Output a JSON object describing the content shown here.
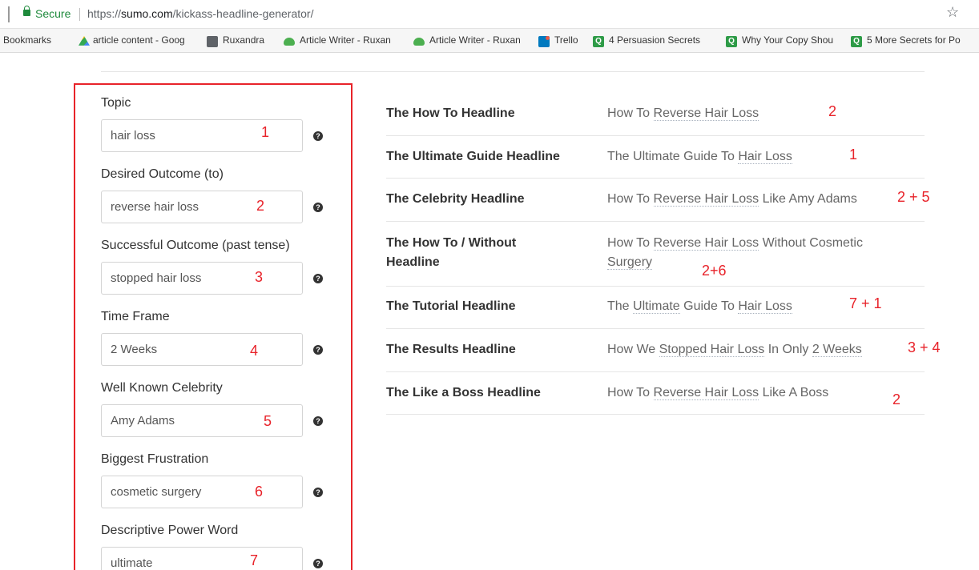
{
  "browser": {
    "secure_label": "Secure",
    "url_scheme": "https://",
    "url_host": "sumo.com",
    "url_path": "/kickass-headline-generator/",
    "bookmarks": [
      {
        "label": "Bookmarks",
        "icon": "none"
      },
      {
        "label": "article content - Goog",
        "icon": "google-drive-icon"
      },
      {
        "label": "Ruxandra",
        "icon": "folder-icon"
      },
      {
        "label": "Article Writer - Ruxan",
        "icon": "cloud-icon"
      },
      {
        "label": "Article Writer - Ruxan",
        "icon": "cloud-icon"
      },
      {
        "label": "Trello",
        "icon": "trello-icon"
      },
      {
        "label": "4 Persuasion Secrets",
        "icon": "q-icon"
      },
      {
        "label": "Why Your Copy Shou",
        "icon": "q-icon"
      },
      {
        "label": "5 More Secrets for Po",
        "icon": "q-icon"
      }
    ]
  },
  "form": {
    "fields": [
      {
        "label": "Topic",
        "value": "hair loss",
        "annotation": "1"
      },
      {
        "label": "Desired Outcome (to)",
        "value": "reverse hair loss",
        "annotation": "2"
      },
      {
        "label": "Successful Outcome (past tense)",
        "value": "stopped hair loss",
        "annotation": "3"
      },
      {
        "label": "Time Frame",
        "value": "2 Weeks",
        "annotation": "4"
      },
      {
        "label": "Well Known Celebrity",
        "value": "Amy Adams",
        "annotation": "5"
      },
      {
        "label": "Biggest Frustration",
        "value": "cosmetic surgery",
        "annotation": "6"
      },
      {
        "label": "Descriptive Power Word",
        "value": "ultimate",
        "annotation": "7"
      }
    ],
    "help_glyph": "?"
  },
  "headlines": [
    {
      "name": "The How To Headline",
      "parts": [
        "How To ",
        "Reverse Hair Loss",
        ""
      ],
      "annotation": "2"
    },
    {
      "name": "The Ultimate Guide Headline",
      "parts": [
        "The Ultimate Guide To ",
        "Hair Loss",
        ""
      ],
      "annotation": "1"
    },
    {
      "name": "The Celebrity Headline",
      "parts": [
        "How To ",
        "Reverse Hair Loss",
        " Like Amy Adams"
      ],
      "annotation": "2 + 5"
    },
    {
      "name": "The How To / Without Headline",
      "parts": [
        "How To ",
        "Reverse Hair Loss",
        " Without Cosmetic ",
        "Surgery"
      ],
      "annotation": "2+6"
    },
    {
      "name": "The Tutorial Headline",
      "parts": [
        "The ",
        "Ultimate",
        " Guide To ",
        "Hair Loss"
      ],
      "annotation": "7 + 1"
    },
    {
      "name": "The Results Headline",
      "parts": [
        "How We ",
        "Stopped Hair Loss",
        " In Only ",
        "2 Weeks"
      ],
      "annotation": "3 + 4"
    },
    {
      "name": "The Like a Boss Headline",
      "parts": [
        "How To ",
        "Reverse Hair Loss",
        " Like A Boss",
        ""
      ],
      "annotation": "2"
    }
  ],
  "colors": {
    "annotation": "#e8232a",
    "secure": "#1e8a3c"
  }
}
